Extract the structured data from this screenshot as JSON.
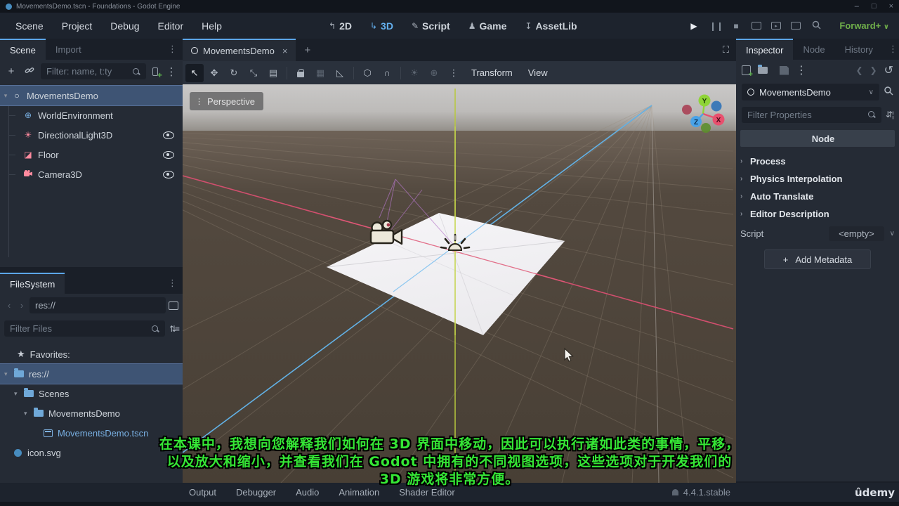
{
  "window": {
    "title": "MovementsDemo.tscn - Foundations - Godot Engine",
    "minimize": "–",
    "maximize": "□",
    "close": "×"
  },
  "menubar": {
    "items": [
      "Scene",
      "Project",
      "Debug",
      "Editor",
      "Help"
    ],
    "workspaces": [
      "2D",
      "3D",
      "Script",
      "Game",
      "AssetLib"
    ],
    "run_profile": "Forward+"
  },
  "scene_dock": {
    "tabs": [
      "Scene",
      "Import"
    ],
    "filter_placeholder": "Filter: name, t:ty",
    "tree": [
      {
        "name": "MovementsDemo"
      },
      {
        "name": "WorldEnvironment"
      },
      {
        "name": "DirectionalLight3D"
      },
      {
        "name": "Floor"
      },
      {
        "name": "Camera3D"
      }
    ]
  },
  "filesystem": {
    "tab": "FileSystem",
    "path_value": "res://",
    "filter_placeholder": "Filter Files",
    "favorites_label": "Favorites:",
    "root": "res://",
    "folder1": "Scenes",
    "folder2": "MovementsDemo",
    "scene_file": "MovementsDemo.tscn",
    "icon_file": "icon.svg"
  },
  "main": {
    "scene_tab": "MovementsDemo",
    "close_tab": "×",
    "transform_menu": "Transform",
    "view_menu": "View",
    "perspective_label": "Perspective",
    "bottom_tabs": [
      "Output",
      "Debugger",
      "Audio",
      "Animation",
      "Shader Editor"
    ],
    "version": "4.4.1.stable"
  },
  "viewport": {
    "gizmo": {
      "x": "X",
      "y": "Y",
      "z": "Z"
    },
    "axis_colors": {
      "x": "#d14f6e",
      "y": "#b7c83d",
      "z": "#62b1e5"
    }
  },
  "inspector": {
    "tabs": [
      "Inspector",
      "Node",
      "History"
    ],
    "node_name": "MovementsDemo",
    "filter_placeholder": "Filter Properties",
    "section_header": "Node",
    "categories": [
      "Process",
      "Physics Interpolation",
      "Auto Translate",
      "Editor Description"
    ],
    "script_label": "Script",
    "script_value": "<empty>",
    "add_metadata_label": "Add Metadata"
  },
  "subtitles": {
    "lines": [
      "在本课中，我想向您解释我们如何在 3D 界面中移动，因此可以执行诸如此类的事情，平移，",
      "以及放大和缩小，并查看我们在 Godot 中拥有的不同视图选项，这些选项对于开发我们的",
      "3D 游戏将非常方便。"
    ]
  },
  "watermark": "ûdemy"
}
